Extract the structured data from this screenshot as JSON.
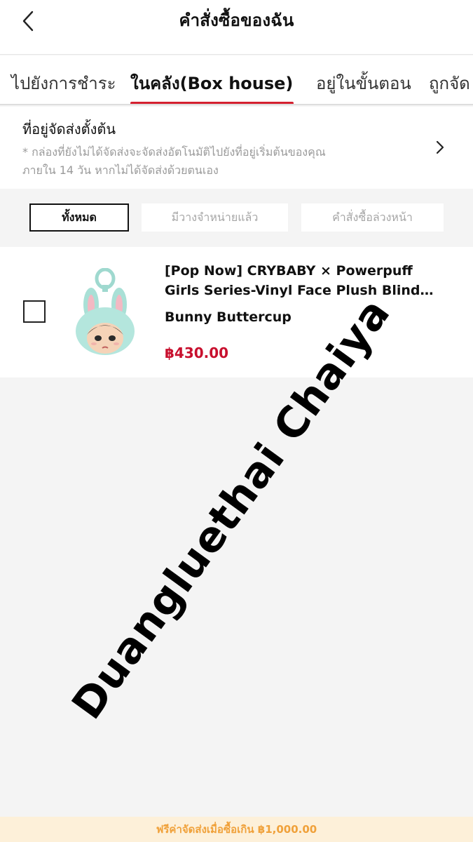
{
  "header": {
    "title": "คำสั่งซื้อของฉัน"
  },
  "tabs": [
    {
      "label": "ไปยังการชำระ"
    },
    {
      "label": "ในคลัง(Box house)"
    },
    {
      "label": "อยู่ในขั้นตอน"
    },
    {
      "label": "ถูกจัด"
    }
  ],
  "active_tab": "ในคลัง(Box house)",
  "address": {
    "title": "ที่อยู่จัดส่งตั้งต้น",
    "note": "* กล่องที่ยังไม่ได้จัดส่งจะจัดส่งอัตโนมัติไปยังที่อยู่เริ่มต้นของคุณภายใน 14 วัน หากไม่ได้จัดส่งด้วยตนเอง"
  },
  "filters": [
    {
      "label": "ทั้งหมด"
    },
    {
      "label": "มีวางจำหน่ายแล้ว"
    },
    {
      "label": "คำสั่งซื้อล่วงหน้า"
    }
  ],
  "active_filter": "ทั้งหมด",
  "product": {
    "name": "[Pop Now] CRYBABY × Powerpuff Girls Series-Vinyl Face Plush Blind Box",
    "variant": "Bunny Buttercup",
    "price": "฿430.00",
    "checked": false
  },
  "watermark": "Duangluethai Chaiya",
  "promo": "ฟรีค่าจัดส่งเมื่อซื้อเกิน ฿1,000.00",
  "colors": {
    "accent": "#d4202f",
    "price": "#c8102e",
    "promo_text": "#f0a13a",
    "promo_bg": "#fdf0d9"
  }
}
